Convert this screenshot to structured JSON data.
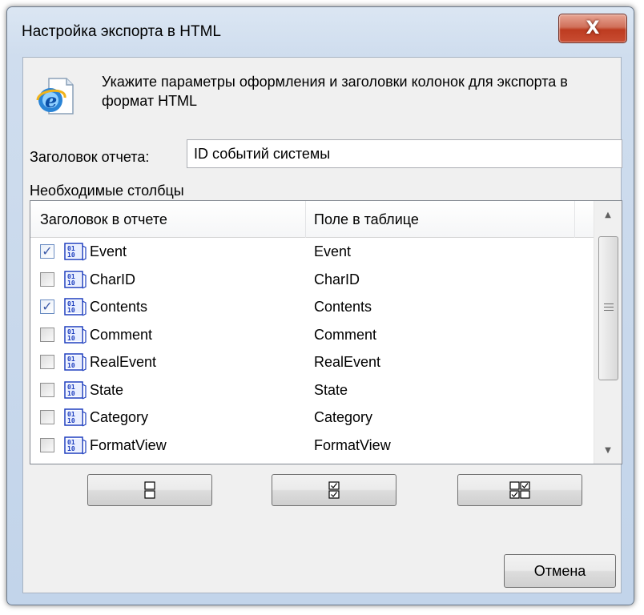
{
  "window": {
    "title": "Настройка экспорта в HTML",
    "close_glyph": "X"
  },
  "info": {
    "icon": "internet-explorer-document-icon",
    "text": "Укажите параметры оформления и заголовки колонок для экспорта в формат HTML"
  },
  "report_title": {
    "label": "Заголовок отчета:",
    "value": "ID событий системы"
  },
  "columns": {
    "section_label": "Необходимые столбцы",
    "header_caption": "Заголовок в отчете",
    "header_field": "Поле в таблице",
    "rows": [
      {
        "name": "Event",
        "field": "Event",
        "checked": true
      },
      {
        "name": "CharID",
        "field": "CharID",
        "checked": false
      },
      {
        "name": "Contents",
        "field": "Contents",
        "checked": true
      },
      {
        "name": "Comment",
        "field": "Comment",
        "checked": false
      },
      {
        "name": "RealEvent",
        "field": "RealEvent",
        "checked": false
      },
      {
        "name": "State",
        "field": "State",
        "checked": false
      },
      {
        "name": "Category",
        "field": "Category",
        "checked": false
      },
      {
        "name": "FormatView",
        "field": "FormatView",
        "checked": false
      }
    ],
    "row_icon": "binary-field-icon",
    "scrollbar": {
      "up_glyph": "▲",
      "down_glyph": "▼"
    }
  },
  "toolbar": {
    "buttons": [
      {
        "icon": "uncheck-all-icon"
      },
      {
        "icon": "check-all-icon"
      },
      {
        "icon": "invert-selection-icon"
      }
    ]
  },
  "footer": {
    "cancel_label": "Отмена"
  },
  "colors": {
    "title_bar": "#cfddee",
    "close_button": "#c94d33",
    "checkmark": "#3b59a8",
    "row_icon": "#1f3fbf"
  }
}
